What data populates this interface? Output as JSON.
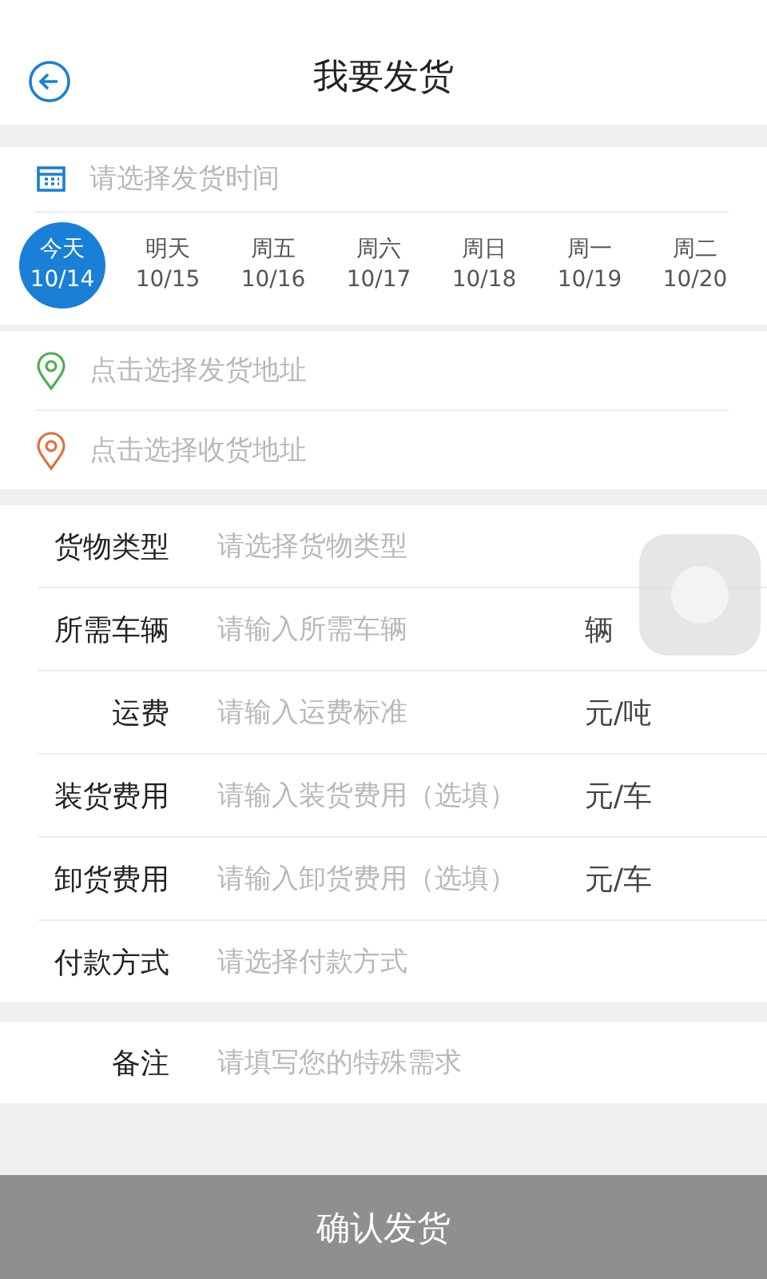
{
  "header": {
    "title": "我要发货"
  },
  "ship_time": {
    "placeholder": "请选择发货时间",
    "dates": [
      {
        "day": "今天",
        "date": "10/14",
        "selected": true
      },
      {
        "day": "明天",
        "date": "10/15",
        "selected": false
      },
      {
        "day": "周五",
        "date": "10/16",
        "selected": false
      },
      {
        "day": "周六",
        "date": "10/17",
        "selected": false
      },
      {
        "day": "周日",
        "date": "10/18",
        "selected": false
      },
      {
        "day": "周一",
        "date": "10/19",
        "selected": false
      },
      {
        "day": "周二",
        "date": "10/20",
        "selected": false
      }
    ]
  },
  "addresses": [
    {
      "placeholder": "点击选择发货地址",
      "color": "#4caf50"
    },
    {
      "placeholder": "点击选择收货地址",
      "color": "#e0703c"
    }
  ],
  "form": [
    {
      "label": "货物类型",
      "placeholder": "请选择货物类型"
    },
    {
      "label": "所需车辆",
      "placeholder": "请输入所需车辆",
      "unit": "辆"
    },
    {
      "label": "运费",
      "placeholder": "请输入运费标准",
      "unit": "元/吨"
    },
    {
      "label": "装货费用",
      "placeholder": "请输入装货费用（选填）",
      "unit": "元/车"
    },
    {
      "label": "卸货费用",
      "placeholder": "请输入卸货费用（选填）",
      "unit": "元/车"
    },
    {
      "label": "付款方式",
      "placeholder": "请选择付款方式"
    }
  ],
  "remark": {
    "label": "备注",
    "placeholder": "请填写您的特殊需求"
  },
  "submit": "确认发货"
}
